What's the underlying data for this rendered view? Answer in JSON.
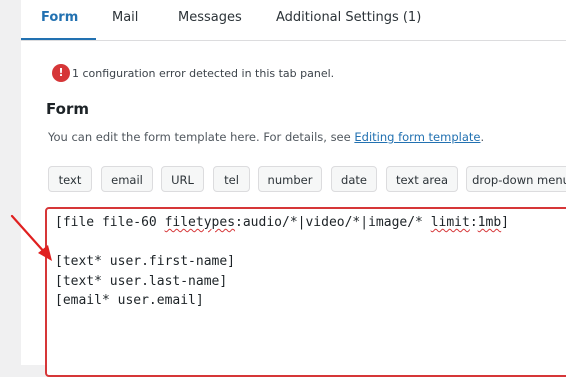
{
  "tabs": [
    {
      "label": "Form",
      "active": true
    },
    {
      "label": "Mail",
      "active": false
    },
    {
      "label": "Messages",
      "active": false
    },
    {
      "label": "Additional Settings (1)",
      "active": false
    }
  ],
  "error": {
    "badge": "!",
    "message": "1 configuration error detected in this tab panel."
  },
  "form_section": {
    "title": "Form",
    "help_text": "You can edit the form template here. For details, see ",
    "help_link": "Editing form template",
    "help_suffix": "."
  },
  "tag_buttons": [
    "text",
    "email",
    "URL",
    "tel",
    "number",
    "date",
    "text area",
    "drop-down menu"
  ],
  "editor": {
    "line1_a": "[file file-60 ",
    "line1_b": "filetypes",
    "line1_c": ":audio/*|video/*|image/* ",
    "line1_d": "limit",
    "line1_e": ":",
    "line1_f": "1mb",
    "line1_g": "]",
    "line3": "[text* user.first-name]",
    "line4": "[text* user.last-name]",
    "line5": "[email* user.email]"
  },
  "colors": {
    "accent": "#2271b1",
    "error": "#d63638",
    "annotation_arrow": "#e02020"
  }
}
